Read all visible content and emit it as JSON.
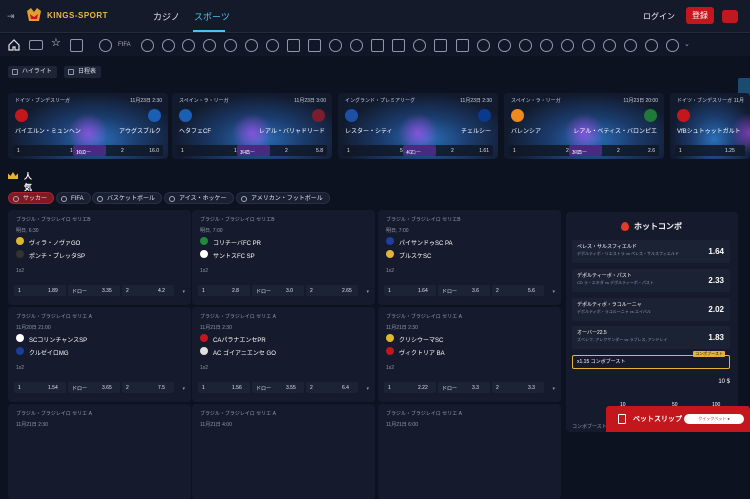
{
  "header": {
    "brand": "KINGS-SPORT",
    "tabs": [
      {
        "label": "カジノ"
      },
      {
        "label": "スポーツ"
      }
    ],
    "login_label": "ログイン",
    "register_label": "登録",
    "accent": "#4cc1f2",
    "brand_red": "#c3171d"
  },
  "sports_nav": {
    "home_icon": "home-icon",
    "fifa_label": "FIFA"
  },
  "chips": [
    {
      "label": "ハイライト"
    },
    {
      "label": "日程表"
    }
  ],
  "highlights": [
    {
      "league": "ドイツ・ブンデスリーガ",
      "date": "11月23日 2:30",
      "home": "バイエルン・ミュンヘン",
      "away": "アウグスブルク",
      "o1": "1.11",
      "draw_label": "ドロー",
      "ox": "10.0",
      "o2": "16.0",
      "l1": "1",
      "l2": "2"
    },
    {
      "league": "スペイン・ラ・リーガ",
      "date": "11月23日 3:00",
      "home": "ヘタフェCF",
      "away": "レアル・バリャドリード",
      "o1": "1.68",
      "draw_label": "ドロー",
      "ox": "3.45",
      "o2": "5.8",
      "l1": "1",
      "l2": "2"
    },
    {
      "league": "イングランド・プレミアリーグ",
      "date": "11月23日 2:30",
      "home": "レスター・シティ",
      "away": "チェルシー",
      "o1": "5.0",
      "draw_label": "ドロー",
      "ox": "4.2",
      "o2": "1.61",
      "l1": "1",
      "l2": "2"
    },
    {
      "league": "スペイン・ラ・リーガ",
      "date": "11月23日 20:00",
      "home": "バレンシア",
      "away": "レアル・ベティス・バロンピエ",
      "o1": "2.6",
      "draw_label": "ドロー",
      "ox": "3.05",
      "o2": "2.6",
      "l1": "1",
      "l2": "2"
    },
    {
      "league": "ドイツ・ブンデスリーガ",
      "date": "11月",
      "home": "VfBシュトゥットガルト",
      "away": "",
      "o1": "1.25",
      "draw_label": "",
      "ox": "",
      "o2": "",
      "l1": "1",
      "l2": ""
    }
  ],
  "popular": {
    "title": "人気",
    "sport_tabs": [
      {
        "label": "サッカー"
      },
      {
        "label": "FIFA"
      },
      {
        "label": "バスケットボール"
      },
      {
        "label": "アイス・ホッケー"
      },
      {
        "label": "アメリカン・フットボール"
      }
    ]
  },
  "matches": [
    {
      "league": "ブラジル・ブラジレイロ セリエB",
      "time": "明日, 6:30",
      "home": "ヴィラ・ノヴァGO",
      "away": "ポンチ・プレッタSP",
      "market": "1x2",
      "l1": "1",
      "o1": "1.89",
      "draw_label": "ドロー",
      "ox": "3.35",
      "l2": "2",
      "o2": "4.2"
    },
    {
      "league": "ブラジル・ブラジレイロ セリエB",
      "time": "明日, 7:00",
      "home": "コリチーバFC PR",
      "away": "サントスFC SP",
      "market": "1x2",
      "l1": "1",
      "o1": "2.8",
      "draw_label": "ドロー",
      "ox": "3.0",
      "l2": "2",
      "o2": "2.65"
    },
    {
      "league": "ブラジル・ブラジレイロ セリエB",
      "time": "明日, 7:00",
      "home": "パイサンドゥSC PA",
      "away": "ブルスケSC",
      "market": "1x2",
      "l1": "1",
      "o1": "1.64",
      "draw_label": "ドロー",
      "ox": "3.6",
      "l2": "2",
      "o2": "5.6"
    },
    {
      "league": "ブラジル・ブラジレイロ セリエ A",
      "time": "11月20日 21:00",
      "home": "SCコリンチャンスSP",
      "away": "クルゼイロMG",
      "market": "1x2",
      "l1": "1",
      "o1": "1.54",
      "draw_label": "ドロー",
      "ox": "3.65",
      "l2": "2",
      "o2": "7.5"
    },
    {
      "league": "ブラジル・ブラジレイロ セリエ A",
      "time": "11月21日 2:30",
      "home": "CAパラナエンセPR",
      "away": "AC ゴイアニエンセ GO",
      "market": "1x2",
      "l1": "1",
      "o1": "1.56",
      "draw_label": "ドロー",
      "ox": "3.55",
      "l2": "2",
      "o2": "6.4"
    },
    {
      "league": "ブラジル・ブラジレイロ セリエ A",
      "time": "11月21日 2:30",
      "home": "クリシウーマSC",
      "away": "ヴィクトリア BA",
      "market": "1x2",
      "l1": "1",
      "o1": "2.22",
      "draw_label": "ドロー",
      "ox": "3.3",
      "l2": "2",
      "o2": "3.3"
    },
    {
      "league": "ブラジル・ブラジレイロ セリエ A",
      "time": "11月21日 2:30",
      "home": "",
      "away": "",
      "market": "",
      "l1": "",
      "o1": "",
      "draw_label": "",
      "ox": "",
      "l2": "",
      "o2": ""
    },
    {
      "league": "ブラジル・ブラジレイロ セリエ A",
      "time": "11月21日 4:00",
      "home": "",
      "away": "",
      "market": "",
      "l1": "",
      "o1": "",
      "draw_label": "",
      "ox": "",
      "l2": "",
      "o2": ""
    },
    {
      "league": "ブラジル・ブラジレイロ セリエ A",
      "time": "11月21日 6:00",
      "home": "",
      "away": "",
      "market": "",
      "l1": "",
      "o1": "",
      "draw_label": "",
      "ox": "",
      "l2": "",
      "o2": ""
    }
  ],
  "hot_combo": {
    "title": "ホットコンボ",
    "items": [
      {
        "head": "ペレス・サルスフィエルド",
        "sub": "デポルティボ・リエストラ vs ペレス・サルスフィエルド",
        "sub2": "1x2",
        "odd": "1.64"
      },
      {
        "head": "デポルティーボ・パスト",
        "sub": "CD ラ・エキダ vs デポルティーボ・パスト",
        "sub2": "1x2",
        "odd": "2.33"
      },
      {
        "head": "デポルティボ・ラコルーニャ",
        "sub": "デポルティボ・ラコルーニャ vs エイバル",
        "sub2": "1x2",
        "odd": "2.02"
      },
      {
        "head": "オーバー22.5",
        "sub": "ズベレフ, アレクサンダー vs ラブレス, アンドレイ",
        "sub2": "総ゲーム数",
        "odd": "1.83"
      }
    ],
    "boost_label": "x1.15 コンボブースト",
    "boost_tag": "コンボブースト",
    "amount": "10 $",
    "stakes": [
      "10",
      "50",
      "100"
    ],
    "boost_footer": "コンボブースト"
  },
  "betslip": {
    "label": "ベットスリップ",
    "quick_label": "クイックベット ●"
  }
}
